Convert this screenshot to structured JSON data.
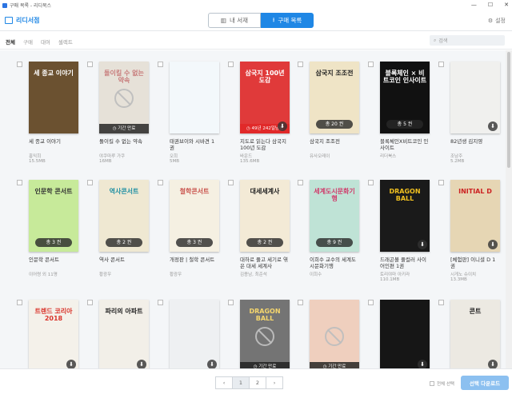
{
  "window": {
    "title": "구매 목록 - 리디북스"
  },
  "header": {
    "logo": "리디서점",
    "tab_library": "내 서재",
    "tab_purchased": "구매 목록",
    "settings": "설정"
  },
  "filters": {
    "items": [
      "전체",
      "구매",
      "대여",
      "셀렉트"
    ],
    "search_placeholder": "검색"
  },
  "colors": {
    "accent": "#1f87e5",
    "rental_badge": "#e12828"
  },
  "books": [
    {
      "title": "세 종교 이야기",
      "author": "홍익희",
      "size": "15.5MB",
      "cover_text": "세 종교 이야기",
      "bg": "#6b5130",
      "fg": "#fff",
      "badge": "",
      "badge_type": "",
      "icon": "",
      "noimg": false
    },
    {
      "title": "돌이킬 수 없는 약속",
      "author": "야쿠마루 가쿠",
      "size": "16MB",
      "cover_text": "돌이킬 수 없는 약속",
      "bg": "#d9d2c4",
      "fg": "#a33",
      "badge": "기간 만료",
      "badge_type": "exp",
      "icon": "",
      "noimg": true
    },
    {
      "title": "태권브이와 시바견 1권",
      "author": "오희",
      "size": "5MB",
      "cover_text": "",
      "bg": "#f3f8fb",
      "fg": "#58a",
      "badge": "",
      "badge_type": "",
      "icon": "",
      "noimg": false
    },
    {
      "title": "지도로 읽는다 삼국지 100년 도감",
      "author": "바운드",
      "size": "135.6MB",
      "cover_text": "삼국지 100년 도감",
      "bg": "#e03a3a",
      "fg": "#fff",
      "badge": "49년 242일남음",
      "badge_type": "rent",
      "icon": "download",
      "noimg": false
    },
    {
      "title": "삼국지 조조전",
      "author": "유사오레이",
      "size": "",
      "cover_text": "삼국지 조조전",
      "bg": "#efe4c6",
      "fg": "#222",
      "badge": "총 20 권",
      "badge_type": "vol",
      "icon": "",
      "noimg": false
    },
    {
      "title": "블록체인X비트코인 인사이트",
      "author": "리더북스",
      "size": "",
      "cover_text": "블록체인 × 비트코인 인사이트",
      "bg": "#111",
      "fg": "#fff",
      "badge": "총 5 권",
      "badge_type": "vol",
      "icon": "",
      "noimg": false
    },
    {
      "title": "82년생 김지영",
      "author": "조남주",
      "size": "5.2MB",
      "cover_text": "",
      "bg": "#f0f0ee",
      "fg": "#333",
      "badge": "",
      "badge_type": "",
      "icon": "download",
      "noimg": false
    },
    {
      "title": "인문학 콘서트",
      "author": "이어령 외 11명",
      "size": "",
      "cover_text": "인문학 콘서트",
      "bg": "#c7ea9a",
      "fg": "#333",
      "badge": "총 3 권",
      "badge_type": "vol",
      "icon": "",
      "noimg": false
    },
    {
      "title": "역사 콘서트",
      "author": "황광우",
      "size": "",
      "cover_text": "역사콘서트",
      "bg": "#efe8d2",
      "fg": "#1e8fa3",
      "badge": "총 2 권",
      "badge_type": "vol",
      "icon": "",
      "noimg": false
    },
    {
      "title": "개정판 | 철학 콘서트",
      "author": "황광우",
      "size": "",
      "cover_text": "철학콘서트",
      "bg": "#f5f0e2",
      "fg": "#c9534d",
      "badge": "총 3 권",
      "badge_type": "vol",
      "icon": "",
      "noimg": false
    },
    {
      "title": "대하로 풀고 세기로 엮은 대세 세계사",
      "author": "김용남, 최준석",
      "size": "",
      "cover_text": "대세세계사",
      "bg": "#f3ead6",
      "fg": "#222",
      "badge": "총 2 권",
      "badge_type": "vol",
      "icon": "",
      "noimg": false
    },
    {
      "title": "이희수 교수의 세계도시문화기행",
      "author": "이희수",
      "size": "",
      "cover_text": "세계도시문화기행",
      "bg": "#bfe3d6",
      "fg": "#d03a6a",
      "badge": "총 9 권",
      "badge_type": "vol",
      "icon": "",
      "noimg": false
    },
    {
      "title": "드래곤볼 풀컬러 사이어인편 1권",
      "author": "토리야마 아키라",
      "size": "110.1MB",
      "cover_text": "DRAGON BALL",
      "bg": "#1a1a1a",
      "fg": "#f0c020",
      "badge": "",
      "badge_type": "",
      "icon": "download",
      "noimg": false
    },
    {
      "title": "[체험판] 이니셜 D 1권",
      "author": "시게노 슈이치",
      "size": "13.3MB",
      "cover_text": "INITIAL D",
      "bg": "#e6d6b4",
      "fg": "#c22",
      "badge": "",
      "badge_type": "",
      "icon": "download",
      "noimg": false
    },
    {
      "title": "",
      "author": "",
      "size": "",
      "cover_text": "트렌드 코리아 2018",
      "bg": "#f4f1ea",
      "fg": "#d9342b",
      "badge": "",
      "badge_type": "",
      "icon": "download",
      "noimg": false
    },
    {
      "title": "",
      "author": "",
      "size": "",
      "cover_text": "파리의 아파트",
      "bg": "#f2efe8",
      "fg": "#222",
      "badge": "",
      "badge_type": "",
      "icon": "download",
      "noimg": false
    },
    {
      "title": "",
      "author": "",
      "size": "",
      "cover_text": "",
      "bg": "#eef0f2",
      "fg": "#333",
      "badge": "",
      "badge_type": "",
      "icon": "download",
      "noimg": false
    },
    {
      "title": "",
      "author": "",
      "size": "",
      "cover_text": "DRAGON BALL",
      "bg": "#2a2a2a",
      "fg": "#f0c020",
      "badge": "기간 만료",
      "badge_type": "exp",
      "icon": "",
      "noimg": true
    },
    {
      "title": "",
      "author": "",
      "size": "",
      "cover_text": "",
      "bg": "#e7b59c",
      "fg": "#333",
      "badge": "기간 만료",
      "badge_type": "exp",
      "icon": "",
      "noimg": true
    },
    {
      "title": "",
      "author": "",
      "size": "",
      "cover_text": "",
      "bg": "#161616",
      "fg": "#fff",
      "badge": "",
      "badge_type": "",
      "icon": "download",
      "noimg": false
    },
    {
      "title": "",
      "author": "",
      "size": "",
      "cover_text": "콘트",
      "bg": "#ece9e2",
      "fg": "#222",
      "badge": "",
      "badge_type": "",
      "icon": "download",
      "noimg": false
    }
  ],
  "pagination": {
    "pages": [
      "‹",
      "1",
      "2",
      "›"
    ],
    "current": "1"
  },
  "footer": {
    "select_all": "전체 선택",
    "download_button": "선택 다운로드"
  }
}
